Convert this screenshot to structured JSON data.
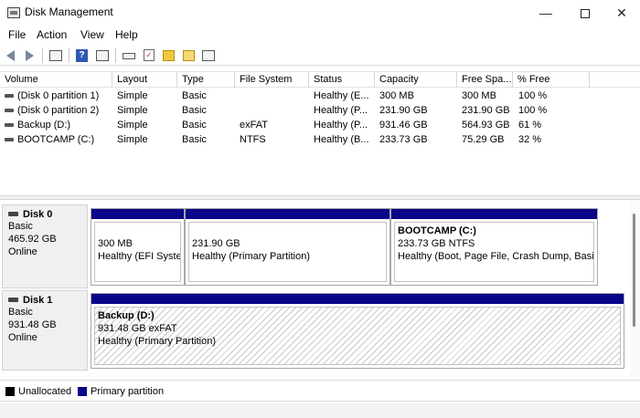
{
  "window": {
    "title": "Disk Management",
    "min_glyph": "—",
    "close_glyph": "✕"
  },
  "menu": [
    "File",
    "Action",
    "View",
    "Help"
  ],
  "toolbar": [
    "back-icon",
    "forward-icon",
    "console-icon",
    "help-icon",
    "properties-icon",
    "connect-icon",
    "check-icon",
    "up-icon",
    "folder-icon",
    "console-tree-icon"
  ],
  "table": {
    "headers": [
      "Volume",
      "Layout",
      "Type",
      "File System",
      "Status",
      "Capacity",
      "Free Spa...",
      "% Free"
    ],
    "rows": [
      [
        "(Disk 0 partition 1)",
        "Simple",
        "Basic",
        "",
        "Healthy (E...",
        "300 MB",
        "300 MB",
        "100 %"
      ],
      [
        "(Disk 0 partition 2)",
        "Simple",
        "Basic",
        "",
        "Healthy (P...",
        "231.90 GB",
        "231.90 GB",
        "100 %"
      ],
      [
        "Backup  (D:)",
        "Simple",
        "Basic",
        "exFAT",
        "Healthy (P...",
        "931.46 GB",
        "564.93 GB",
        "61 %"
      ],
      [
        "BOOTCAMP (C:)",
        "Simple",
        "Basic",
        "NTFS",
        "Healthy (B...",
        "233.73 GB",
        "75.29 GB",
        "32 %"
      ]
    ]
  },
  "disks": [
    {
      "name": "Disk 0",
      "type": "Basic",
      "size": "465.92 GB",
      "state": "Online",
      "partitions": [
        {
          "title": "",
          "line1": "300 MB",
          "line2": "Healthy (EFI System Partition)"
        },
        {
          "title": "",
          "line1": "231.90 GB",
          "line2": "Healthy (Primary Partition)"
        },
        {
          "title": "BOOTCAMP  (C:)",
          "line1": "233.73 GB NTFS",
          "line2": "Healthy (Boot, Page File, Crash Dump, Basic Data Partition)"
        }
      ]
    },
    {
      "name": "Disk 1",
      "type": "Basic",
      "size": "931.48 GB",
      "state": "Online",
      "partitions": [
        {
          "title": "Backup   (D:)",
          "line1": "931.48 GB exFAT",
          "line2": "Healthy (Primary Partition)"
        }
      ]
    }
  ],
  "legend": [
    {
      "label": "Unallocated",
      "color": "#000000"
    },
    {
      "label": "Primary partition",
      "color": "#09068a"
    }
  ]
}
